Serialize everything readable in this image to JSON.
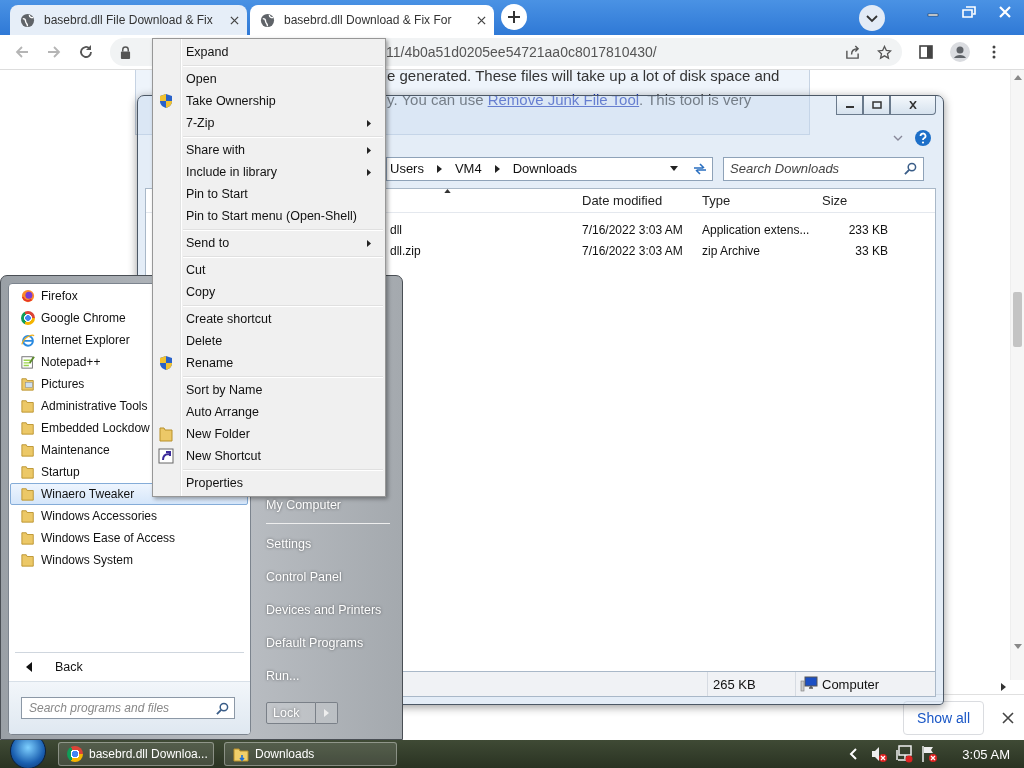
{
  "browser": {
    "tabs": [
      {
        "title": "basebrd.dll File Download & Fix",
        "selected": false
      },
      {
        "title": "basebrd.dll Download & Fix For",
        "selected": true
      }
    ],
    "address": "11/4b0a51d0205ee54721aa0c8017810430/",
    "article": {
      "line_1": "e generated. These files will take up a lot of disk space and",
      "line_2_before": "y. You can use ",
      "link": "Remove Junk File Tool",
      "line_2_after": ". This tool is very"
    },
    "download_bar": {
      "show_all": "Show all"
    }
  },
  "explorer": {
    "path": [
      "Users",
      "VM4",
      "Downloads"
    ],
    "search": {
      "placeholder": "Search Downloads"
    },
    "columns": [
      "Date modified",
      "Type",
      "Size"
    ],
    "rows": [
      {
        "name": "dll",
        "date": "7/16/2022 3:03 AM",
        "type": "Application extens...",
        "size": "233 KB"
      },
      {
        "name": "dll.zip",
        "date": "7/16/2022 3:03 AM",
        "type": "zip Archive",
        "size": "33 KB"
      }
    ],
    "status": {
      "size": "265 KB",
      "zone": "Computer"
    }
  },
  "start_menu": {
    "programs": [
      {
        "label": "Firefox",
        "kind": "firefox",
        "selected": false
      },
      {
        "label": "Google Chrome",
        "kind": "chrome",
        "selected": false
      },
      {
        "label": "Internet Explorer",
        "kind": "ie",
        "selected": false
      },
      {
        "label": "Notepad++",
        "kind": "notepad",
        "selected": false
      },
      {
        "label": "Pictures",
        "kind": "pictures",
        "selected": false
      },
      {
        "label": "Administrative Tools",
        "kind": "folder",
        "selected": false
      },
      {
        "label": "Embedded Lockdow",
        "kind": "folder",
        "selected": false
      },
      {
        "label": "Maintenance",
        "kind": "folder",
        "selected": false
      },
      {
        "label": "Startup",
        "kind": "folder",
        "selected": false
      },
      {
        "label": "Winaero Tweaker",
        "kind": "folder",
        "selected": true
      },
      {
        "label": "Windows Accessories",
        "kind": "folder",
        "selected": false
      },
      {
        "label": "Windows Ease of Access",
        "kind": "folder",
        "selected": false
      },
      {
        "label": "Windows System",
        "kind": "folder",
        "selected": false
      }
    ],
    "back": "Back",
    "search": {
      "placeholder": "Search programs and files"
    },
    "places_top": [
      "My Computer"
    ],
    "places": [
      "Settings",
      "Control Panel",
      "Devices and Printers",
      "Default Programs",
      "Run..."
    ],
    "shutdown": "Lock"
  },
  "context_menu": {
    "sections": [
      {
        "items": [
          {
            "label": "Expand",
            "kind": "plain",
            "submenu": false
          }
        ]
      },
      {
        "items": [
          {
            "label": "Open",
            "kind": "plain",
            "submenu": false
          },
          {
            "label": "Take Ownership",
            "kind": "shield",
            "submenu": false
          },
          {
            "label": "7-Zip",
            "kind": "plain",
            "submenu": true
          }
        ]
      },
      {
        "items": [
          {
            "label": "Share with",
            "kind": "plain",
            "submenu": true
          },
          {
            "label": "Include in library",
            "kind": "plain",
            "submenu": true
          },
          {
            "label": "Pin to Start",
            "kind": "plain",
            "submenu": false
          },
          {
            "label": "Pin to Start menu (Open-Shell)",
            "kind": "plain",
            "submenu": false
          }
        ]
      },
      {
        "items": [
          {
            "label": "Send to",
            "kind": "plain",
            "submenu": true
          }
        ]
      },
      {
        "items": [
          {
            "label": "Cut",
            "kind": "plain",
            "submenu": false
          },
          {
            "label": "Copy",
            "kind": "plain",
            "submenu": false
          }
        ]
      },
      {
        "items": [
          {
            "label": "Create shortcut",
            "kind": "plain",
            "submenu": false
          },
          {
            "label": "Delete",
            "kind": "plain",
            "submenu": false
          },
          {
            "label": "Rename",
            "kind": "shield",
            "submenu": false
          }
        ]
      },
      {
        "items": [
          {
            "label": "Sort by Name",
            "kind": "plain",
            "submenu": false
          },
          {
            "label": "Auto Arrange",
            "kind": "plain",
            "submenu": false
          },
          {
            "label": "New Folder",
            "kind": "folder",
            "submenu": false
          },
          {
            "label": "New Shortcut",
            "kind": "shortcut",
            "submenu": false
          }
        ]
      },
      {
        "items": [
          {
            "label": "Properties",
            "kind": "plain",
            "submenu": false
          }
        ]
      }
    ]
  },
  "taskbar": {
    "tasks": [
      {
        "label": "basebrd.dll Downloa...",
        "kind": "chrome"
      },
      {
        "label": "Downloads",
        "kind": "folder"
      }
    ],
    "clock": "3:05 AM"
  }
}
